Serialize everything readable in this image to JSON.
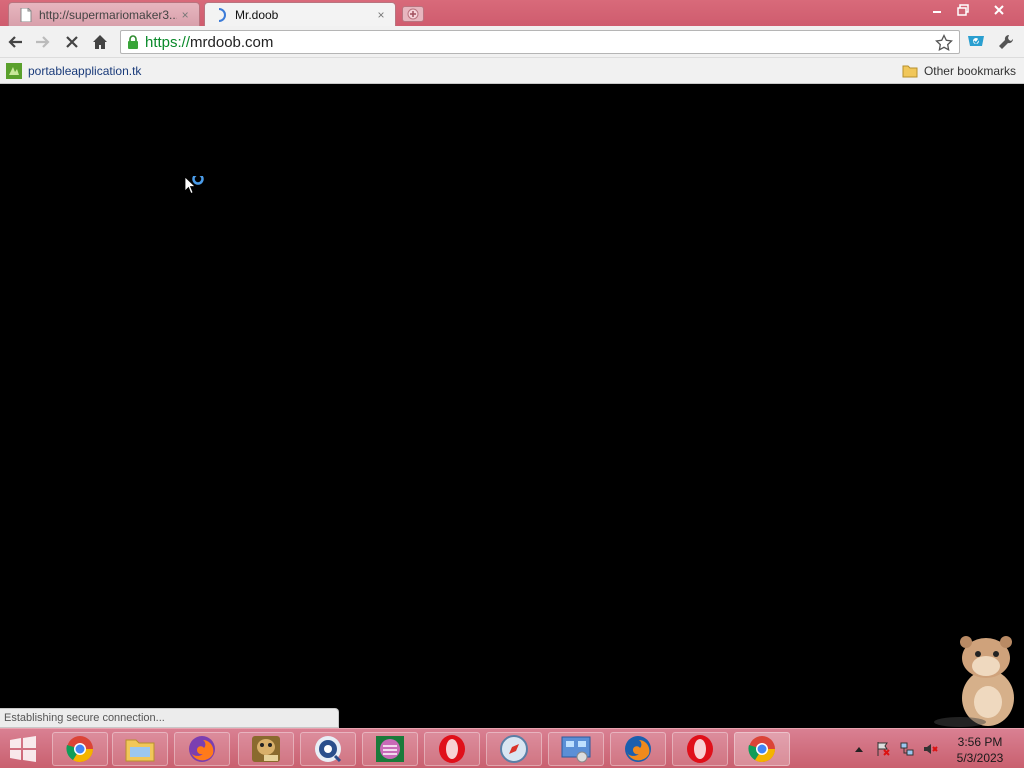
{
  "browser": {
    "tabs": [
      {
        "title": "http://supermariomaker3...",
        "close_label": "×",
        "active": false
      },
      {
        "title": "Mr.doob",
        "close_label": "×",
        "active": true
      }
    ],
    "window_controls": {
      "minimize_label": "–",
      "restore_label": "❐",
      "close_label": "✕"
    },
    "toolbar": {
      "url_scheme": "https://",
      "url_host": "mrdoob.com"
    },
    "bookmarks": {
      "items": [
        {
          "label": "portableapplication.tk"
        }
      ],
      "other_label": "Other bookmarks"
    },
    "status_text": "Establishing secure connection...",
    "colors": {
      "frame": "#d86a7a",
      "content": "#000000",
      "url_scheme": "#0a8a2a"
    }
  },
  "taskbar": {
    "apps": [
      {
        "name": "chrome-icon"
      },
      {
        "name": "file-explorer-icon"
      },
      {
        "name": "firefox-icon"
      },
      {
        "name": "boxer-icon"
      },
      {
        "name": "media-icon"
      },
      {
        "name": "app-icon"
      },
      {
        "name": "opera-icon"
      },
      {
        "name": "safari-icon"
      },
      {
        "name": "control-panel-icon"
      },
      {
        "name": "firefox-icon"
      },
      {
        "name": "opera-icon"
      },
      {
        "name": "chrome-icon"
      }
    ],
    "clock": {
      "time": "3:56 PM",
      "date": "5/3/2023"
    }
  }
}
